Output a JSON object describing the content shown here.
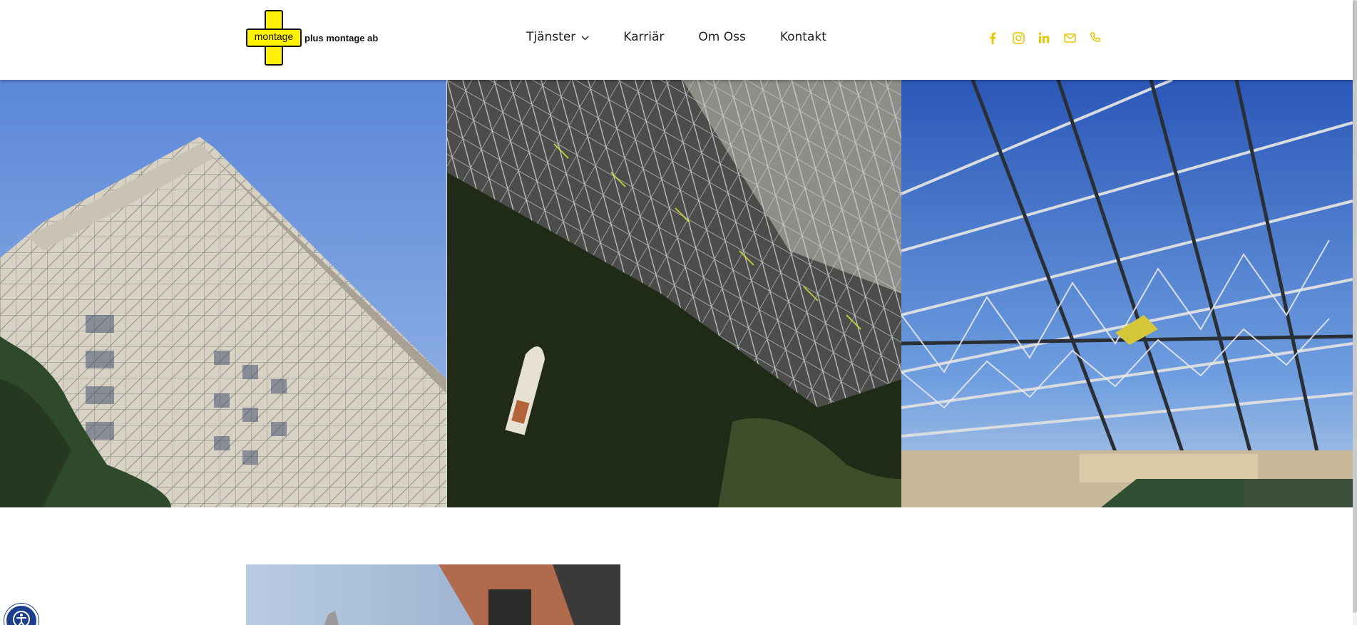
{
  "brand": {
    "logo_word": "montage",
    "name": "plus montage ab",
    "accent_color": "#fff200",
    "social_color": "#e8c600"
  },
  "nav": {
    "items": [
      {
        "label": "Tjänster",
        "has_dropdown": true
      },
      {
        "label": "Karriär"
      },
      {
        "label": "Om Oss"
      },
      {
        "label": "Kontakt"
      }
    ]
  },
  "social_icons": [
    "facebook-icon",
    "instagram-icon",
    "linkedin-icon",
    "email-icon",
    "phone-icon"
  ],
  "gallery": {
    "images": [
      {
        "subject": "building-with-scaffolding"
      },
      {
        "subject": "aerial-scaffolding-over-water"
      },
      {
        "subject": "roof-truss-scaffolding"
      }
    ]
  },
  "accessibility": {
    "icon": "accessibility-icon"
  }
}
